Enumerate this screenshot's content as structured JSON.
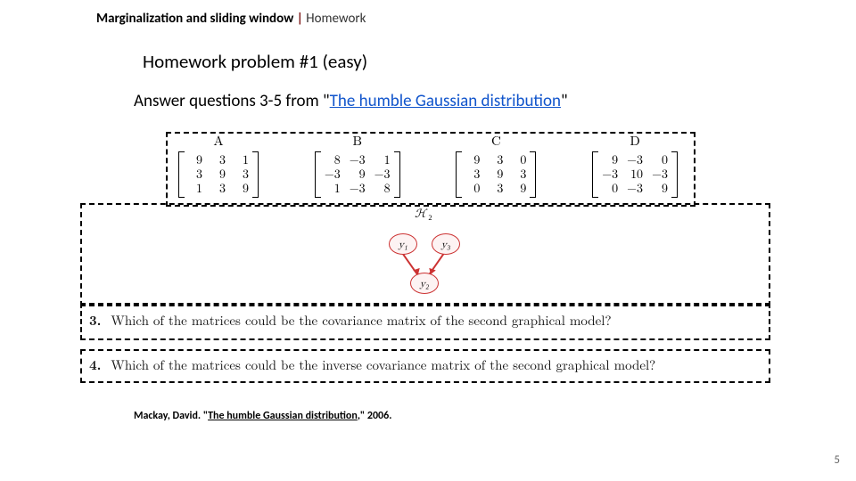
{
  "header": {
    "main": "Marginalization and sliding window",
    "separator": "|",
    "section": "Homework"
  },
  "title": "Homework problem #1 (easy)",
  "prompt": {
    "pre": "Answer questions 3-5 from \"",
    "link": "The humble Gaussian distribution",
    "post": "\""
  },
  "matrices": {
    "A": {
      "label": "A",
      "rows": [
        [
          "9",
          "3",
          "1"
        ],
        [
          "3",
          "9",
          "3"
        ],
        [
          "1",
          "3",
          "9"
        ]
      ]
    },
    "B": {
      "label": "B",
      "rows": [
        [
          "8",
          "−3",
          "1"
        ],
        [
          "−3",
          "9",
          "−3"
        ],
        [
          "1",
          "−3",
          "8"
        ]
      ]
    },
    "C": {
      "label": "C",
      "rows": [
        [
          "9",
          "3",
          "0"
        ],
        [
          "3",
          "9",
          "3"
        ],
        [
          "0",
          "3",
          "9"
        ]
      ]
    },
    "D": {
      "label": "D",
      "rows": [
        [
          "9",
          "−3",
          "0"
        ],
        [
          "−3",
          "10",
          "−3"
        ],
        [
          "0",
          "−3",
          "9"
        ]
      ]
    }
  },
  "graph_model": {
    "model_label": "ℋ₂",
    "nodes": {
      "y1": "y₁",
      "y2": "y₂",
      "y3": "y₃"
    }
  },
  "questions": {
    "q3": {
      "num": "3.",
      "text": "Which of the matrices could be the covariance matrix of the second graphical model?"
    },
    "q4": {
      "num": "4.",
      "text": "Which of the matrices could be the inverse covariance matrix of the second graphical model?"
    }
  },
  "citation": {
    "author": "Mackay, David. \"",
    "title_link": "The humble Gaussian distribution",
    "tail": ",\" 2006."
  },
  "page_number": "5"
}
